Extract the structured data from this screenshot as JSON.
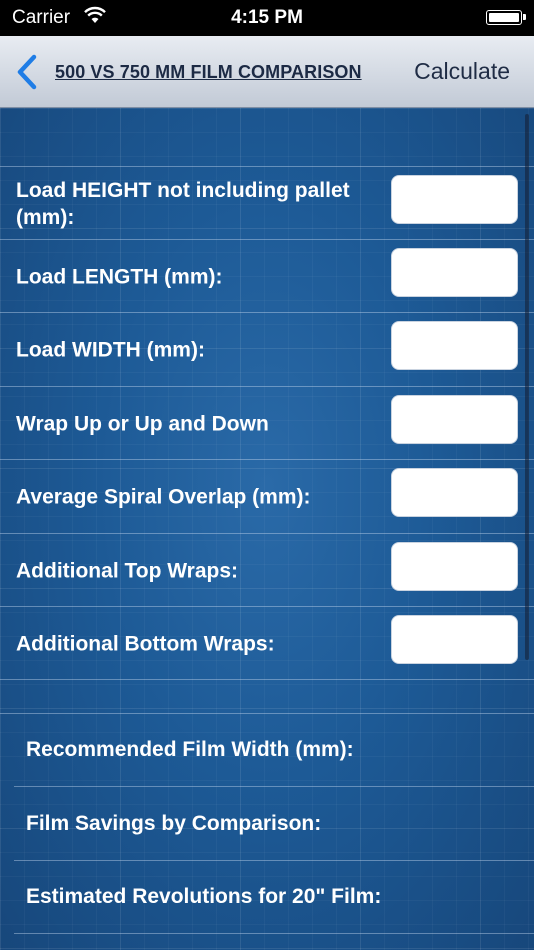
{
  "status_bar": {
    "carrier": "Carrier",
    "time": "4:15 PM"
  },
  "nav": {
    "title": "500 VS 750 MM FILM COMPARISON",
    "calculate_label": "Calculate"
  },
  "inputs": [
    {
      "label": "Load HEIGHT not including pallet (mm):",
      "value": ""
    },
    {
      "label": "Load LENGTH (mm):",
      "value": ""
    },
    {
      "label": "Load WIDTH (mm):",
      "value": ""
    },
    {
      "label": "Wrap Up or Up and Down",
      "value": ""
    },
    {
      "label": "Average Spiral Overlap (mm):",
      "value": ""
    },
    {
      "label": "Additional Top Wraps:",
      "value": ""
    },
    {
      "label": "Additional Bottom Wraps:",
      "value": ""
    }
  ],
  "results": [
    {
      "label": "Recommended Film Width (mm):"
    },
    {
      "label": "Film Savings by Comparison:"
    },
    {
      "label": "Estimated Revolutions for 20\" Film:"
    }
  ]
}
